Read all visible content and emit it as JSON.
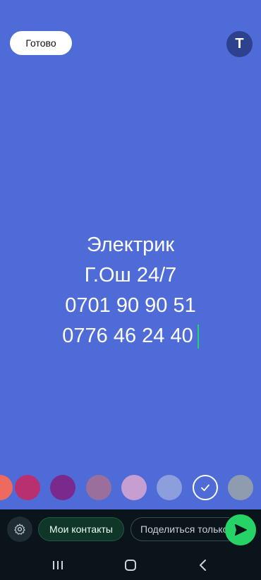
{
  "header": {
    "done_label": "Готово",
    "text_style_label": "T"
  },
  "status": {
    "lines": [
      "Электрик",
      "Г.Ош 24/7",
      "0701 90 90 51",
      "0776 46 24 40"
    ],
    "background": "#4f6bd8",
    "text_color": "#ffffff"
  },
  "palette": {
    "colors": [
      "#ef6a5e",
      "#b8306f",
      "#7a2a8c",
      "#9a6f9c",
      "#c69ed1",
      "#8c9fdc",
      "#4f6bd8",
      "#8f9cb0"
    ],
    "selected_index": 6
  },
  "bottom_bar": {
    "settings_icon": "gear-icon",
    "contacts_label": "Мои контакты",
    "share_label": "Поделиться только с...",
    "send_icon": "send-icon",
    "accent": "#25d366"
  },
  "nav": {
    "recent_icon": "recent-apps-icon",
    "home_icon": "home-icon",
    "back_icon": "back-icon"
  }
}
